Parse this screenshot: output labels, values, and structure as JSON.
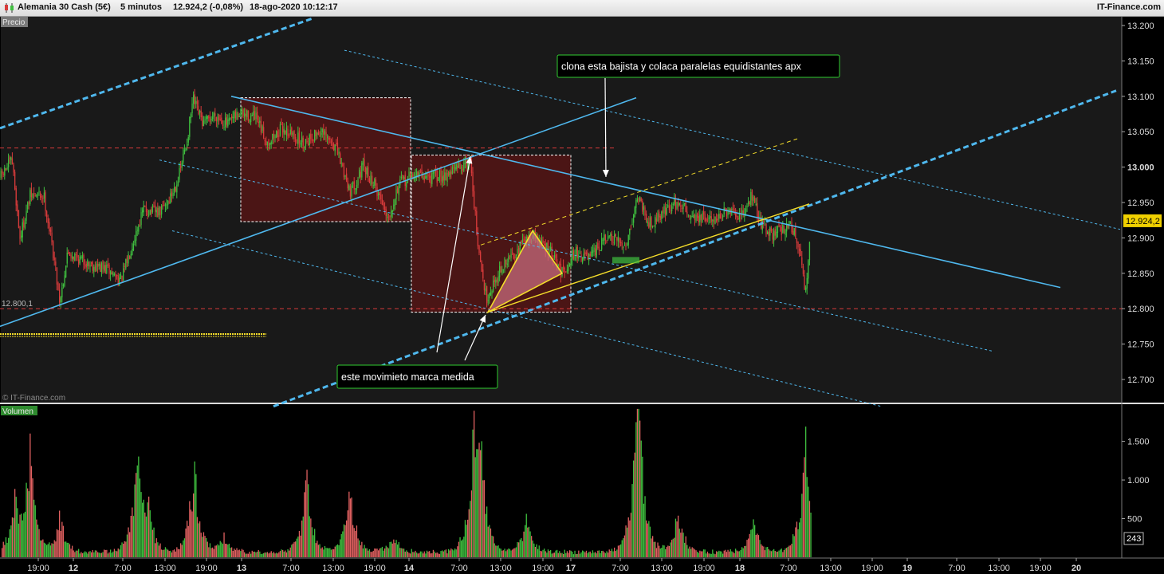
{
  "header": {
    "instrument": "Alemania 30 Cash (5€)",
    "timeframe": "5 minutos",
    "quote": "12.924,2 (-0,08%)",
    "datetime": "18-ago-2020 10:12:17",
    "brand": "IT-Finance.com"
  },
  "price_panel": {
    "label": "Precio",
    "watermark": "© IT-Finance.com",
    "level_label": "12.800,1",
    "current_price": "12.924,2"
  },
  "volume_panel": {
    "label": "Volumen",
    "current_volume": "243"
  },
  "annotations": {
    "top_note": "clona esta bajista y colaca paralelas equidistantes apx",
    "bottom_note": "este movimieto marca  medida"
  },
  "colors": {
    "background": "#000000",
    "panel": "#191919",
    "bull": "#3fbf3f",
    "bear": "#d83b3b",
    "channel": "#4fb8ee",
    "yellow": "#f4dd2a",
    "box": "#5a1414",
    "note_border": "#2fcd2f"
  },
  "chart_data": [
    {
      "type": "candlestick",
      "title": "Alemania 30 Cash (5€) 5 minutos",
      "x_ticks": [
        "19:00",
        "12",
        "7:00",
        "13:00",
        "19:00",
        "13",
        "7:00",
        "13:00",
        "19:00",
        "14",
        "7:00",
        "13:00",
        "19:00",
        "17",
        "7:00",
        "13:00",
        "19:00",
        "18",
        "7:00",
        "13:00",
        "19:00",
        "19",
        "7:00",
        "13:00",
        "19:00",
        "20"
      ],
      "y_ticks": [
        "13.200",
        "13.150",
        "13.100",
        "13.050",
        "13.000",
        "12.950",
        "12.900",
        "12.850",
        "12.800",
        "12.750",
        "12.700"
      ],
      "ylim": [
        12660,
        13215
      ],
      "close_path": [
        {
          "x": 0,
          "y": 12985
        },
        {
          "x": 15,
          "y": 13010
        },
        {
          "x": 25,
          "y": 12900
        },
        {
          "x": 38,
          "y": 12960
        },
        {
          "x": 55,
          "y": 12960
        },
        {
          "x": 68,
          "y": 12870
        },
        {
          "x": 75,
          "y": 12810
        },
        {
          "x": 85,
          "y": 12880
        },
        {
          "x": 100,
          "y": 12870
        },
        {
          "x": 120,
          "y": 12860
        },
        {
          "x": 135,
          "y": 12855
        },
        {
          "x": 152,
          "y": 12840
        },
        {
          "x": 168,
          "y": 12900
        },
        {
          "x": 180,
          "y": 12940
        },
        {
          "x": 200,
          "y": 12935
        },
        {
          "x": 215,
          "y": 12960
        },
        {
          "x": 225,
          "y": 12990
        },
        {
          "x": 235,
          "y": 13040
        },
        {
          "x": 242,
          "y": 13095
        },
        {
          "x": 255,
          "y": 13060
        },
        {
          "x": 270,
          "y": 13075
        },
        {
          "x": 285,
          "y": 13060
        },
        {
          "x": 300,
          "y": 13075
        },
        {
          "x": 320,
          "y": 13070
        },
        {
          "x": 335,
          "y": 13035
        },
        {
          "x": 355,
          "y": 13055
        },
        {
          "x": 380,
          "y": 13035
        },
        {
          "x": 400,
          "y": 13050
        },
        {
          "x": 420,
          "y": 13030
        },
        {
          "x": 440,
          "y": 12965
        },
        {
          "x": 455,
          "y": 13000
        },
        {
          "x": 470,
          "y": 12975
        },
        {
          "x": 487,
          "y": 12930
        },
        {
          "x": 500,
          "y": 12975
        },
        {
          "x": 520,
          "y": 12990
        },
        {
          "x": 540,
          "y": 12985
        },
        {
          "x": 560,
          "y": 12990
        },
        {
          "x": 575,
          "y": 13000
        },
        {
          "x": 590,
          "y": 13010
        },
        {
          "x": 600,
          "y": 12880
        },
        {
          "x": 610,
          "y": 12815
        },
        {
          "x": 625,
          "y": 12850
        },
        {
          "x": 645,
          "y": 12880
        },
        {
          "x": 668,
          "y": 12905
        },
        {
          "x": 690,
          "y": 12880
        },
        {
          "x": 705,
          "y": 12850
        },
        {
          "x": 720,
          "y": 12880
        },
        {
          "x": 740,
          "y": 12870
        },
        {
          "x": 760,
          "y": 12900
        },
        {
          "x": 785,
          "y": 12890
        },
        {
          "x": 800,
          "y": 12960
        },
        {
          "x": 815,
          "y": 12920
        },
        {
          "x": 835,
          "y": 12940
        },
        {
          "x": 850,
          "y": 12950
        },
        {
          "x": 870,
          "y": 12930
        },
        {
          "x": 890,
          "y": 12925
        },
        {
          "x": 910,
          "y": 12935
        },
        {
          "x": 930,
          "y": 12930
        },
        {
          "x": 942,
          "y": 12960
        },
        {
          "x": 955,
          "y": 12920
        },
        {
          "x": 970,
          "y": 12905
        },
        {
          "x": 990,
          "y": 12920
        },
        {
          "x": 1000,
          "y": 12900
        },
        {
          "x": 1010,
          "y": 12820
        },
        {
          "x": 1018,
          "y": 12924
        }
      ],
      "annotation_lines": [
        {
          "kind": "solid",
          "color": "#4fb8ee",
          "from": {
            "x": 290,
            "y": 13100
          },
          "to": {
            "x": 1330,
            "y": 12830
          }
        },
        {
          "kind": "solid",
          "color": "#4fb8ee",
          "from": {
            "x": 0,
            "y": 12775
          },
          "to": {
            "x": 798,
            "y": 13098
          }
        },
        {
          "kind": "dashed",
          "color": "#4fb8ee",
          "from": {
            "x": 0,
            "y": 13055
          },
          "to": {
            "x": 392,
            "y": 13210
          }
        },
        {
          "kind": "dashed",
          "color": "#4fb8ee",
          "from": {
            "x": 343,
            "y": 12662
          },
          "to": {
            "x": 1400,
            "y": 13108
          }
        },
        {
          "kind": "dotted",
          "color": "#4fb8ee",
          "from": {
            "x": 432,
            "y": 13165
          },
          "to": {
            "x": 1405,
            "y": 12912
          }
        },
        {
          "kind": "dotted",
          "color": "#4fb8ee",
          "from": {
            "x": 200,
            "y": 13010
          },
          "to": {
            "x": 1245,
            "y": 12740
          }
        },
        {
          "kind": "dotted",
          "color": "#4fb8ee",
          "from": {
            "x": 216,
            "y": 12910
          },
          "to": {
            "x": 1105,
            "y": 12662
          }
        },
        {
          "kind": "solid",
          "color": "#f4dd2a",
          "from": {
            "x": 612,
            "y": 12795
          },
          "to": {
            "x": 1015,
            "y": 12948
          }
        },
        {
          "kind": "dashed",
          "color": "#f4dd2a",
          "from": {
            "x": 603,
            "y": 12890
          },
          "to": {
            "x": 1000,
            "y": 13040
          }
        },
        {
          "kind": "dashed",
          "color": "#d83b3b",
          "from": {
            "x": 0,
            "y": 13027
          },
          "to": {
            "x": 770,
            "y": 13027
          }
        },
        {
          "kind": "dashed",
          "color": "#d83b3b",
          "from": {
            "x": 0,
            "y": 12800
          },
          "to": {
            "x": 1408,
            "y": 12800
          }
        }
      ],
      "annotation_boxes": [
        {
          "x0": 302,
          "x1": 515,
          "y0": 12923,
          "y1": 13098
        },
        {
          "x0": 516,
          "x1": 716,
          "y0": 12795,
          "y1": 13017
        }
      ],
      "triangle": [
        {
          "x": 612,
          "y": 12795
        },
        {
          "x": 668,
          "y": 12910
        },
        {
          "x": 705,
          "y": 12850
        }
      ]
    },
    {
      "type": "bar",
      "title": "Volumen",
      "y_ticks": [
        "1.500",
        "1.000",
        "500"
      ],
      "ylim": [
        0,
        1960
      ],
      "spikes": [
        {
          "x": 18,
          "value": 1000
        },
        {
          "x": 37,
          "value": 1620
        },
        {
          "x": 75,
          "value": 600
        },
        {
          "x": 172,
          "value": 1550
        },
        {
          "x": 185,
          "value": 700
        },
        {
          "x": 243,
          "value": 1550
        },
        {
          "x": 280,
          "value": 250
        },
        {
          "x": 384,
          "value": 1360
        },
        {
          "x": 438,
          "value": 1120
        },
        {
          "x": 493,
          "value": 300
        },
        {
          "x": 594,
          "value": 1780
        },
        {
          "x": 603,
          "value": 1400
        },
        {
          "x": 660,
          "value": 550
        },
        {
          "x": 798,
          "value": 1850
        },
        {
          "x": 802,
          "value": 1100
        },
        {
          "x": 850,
          "value": 750
        },
        {
          "x": 945,
          "value": 520
        },
        {
          "x": 1009,
          "value": 1880
        }
      ]
    }
  ]
}
